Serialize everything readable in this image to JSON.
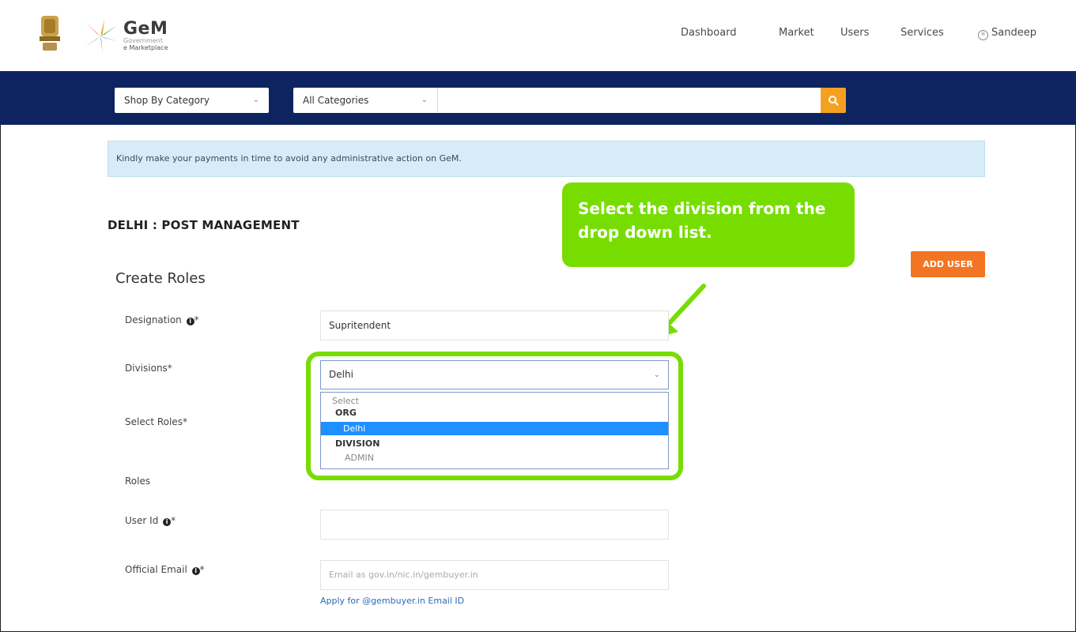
{
  "header": {
    "brand_name": "GeM",
    "brand_sub1": "Government",
    "brand_sub2": "e Marketplace",
    "nav": [
      "Dashboard",
      "Market",
      "Users",
      "Services",
      "Sandeep"
    ]
  },
  "search": {
    "category_select": "Shop By Category",
    "all_categories_select": "All Categories",
    "input_value": ""
  },
  "notice": "Kindly make your payments in time to avoid any administrative action on GeM.",
  "page": {
    "title": "DELHI : POST MANAGEMENT",
    "section_title": "Create Roles",
    "add_user_label": "ADD USER"
  },
  "callout": "Select the division from the drop down list.",
  "form": {
    "designation_label": "Designation",
    "designation_value": "Supritendent",
    "divisions_label": "Divisions*",
    "divisions_value": "Delhi",
    "divisions_options": {
      "select": "Select",
      "group_org": "ORG",
      "delhi": "Delhi",
      "group_division": "DIVISION",
      "admin": "ADMIN"
    },
    "select_roles_label": "Select Roles*",
    "roles_label": "Roles",
    "user_id_label": "User Id",
    "user_id_value": "",
    "official_email_label": "Official Email",
    "official_email_placeholder": "Email as gov.in/nic.in/gembuyer.in",
    "apply_link": "Apply for @gembuyer.in Email ID"
  },
  "colors": {
    "navy": "#0d2461",
    "search_button": "#f4a020",
    "add_user": "#f37524",
    "callout_green": "#77dd00",
    "selected_option": "#1e90ff"
  }
}
